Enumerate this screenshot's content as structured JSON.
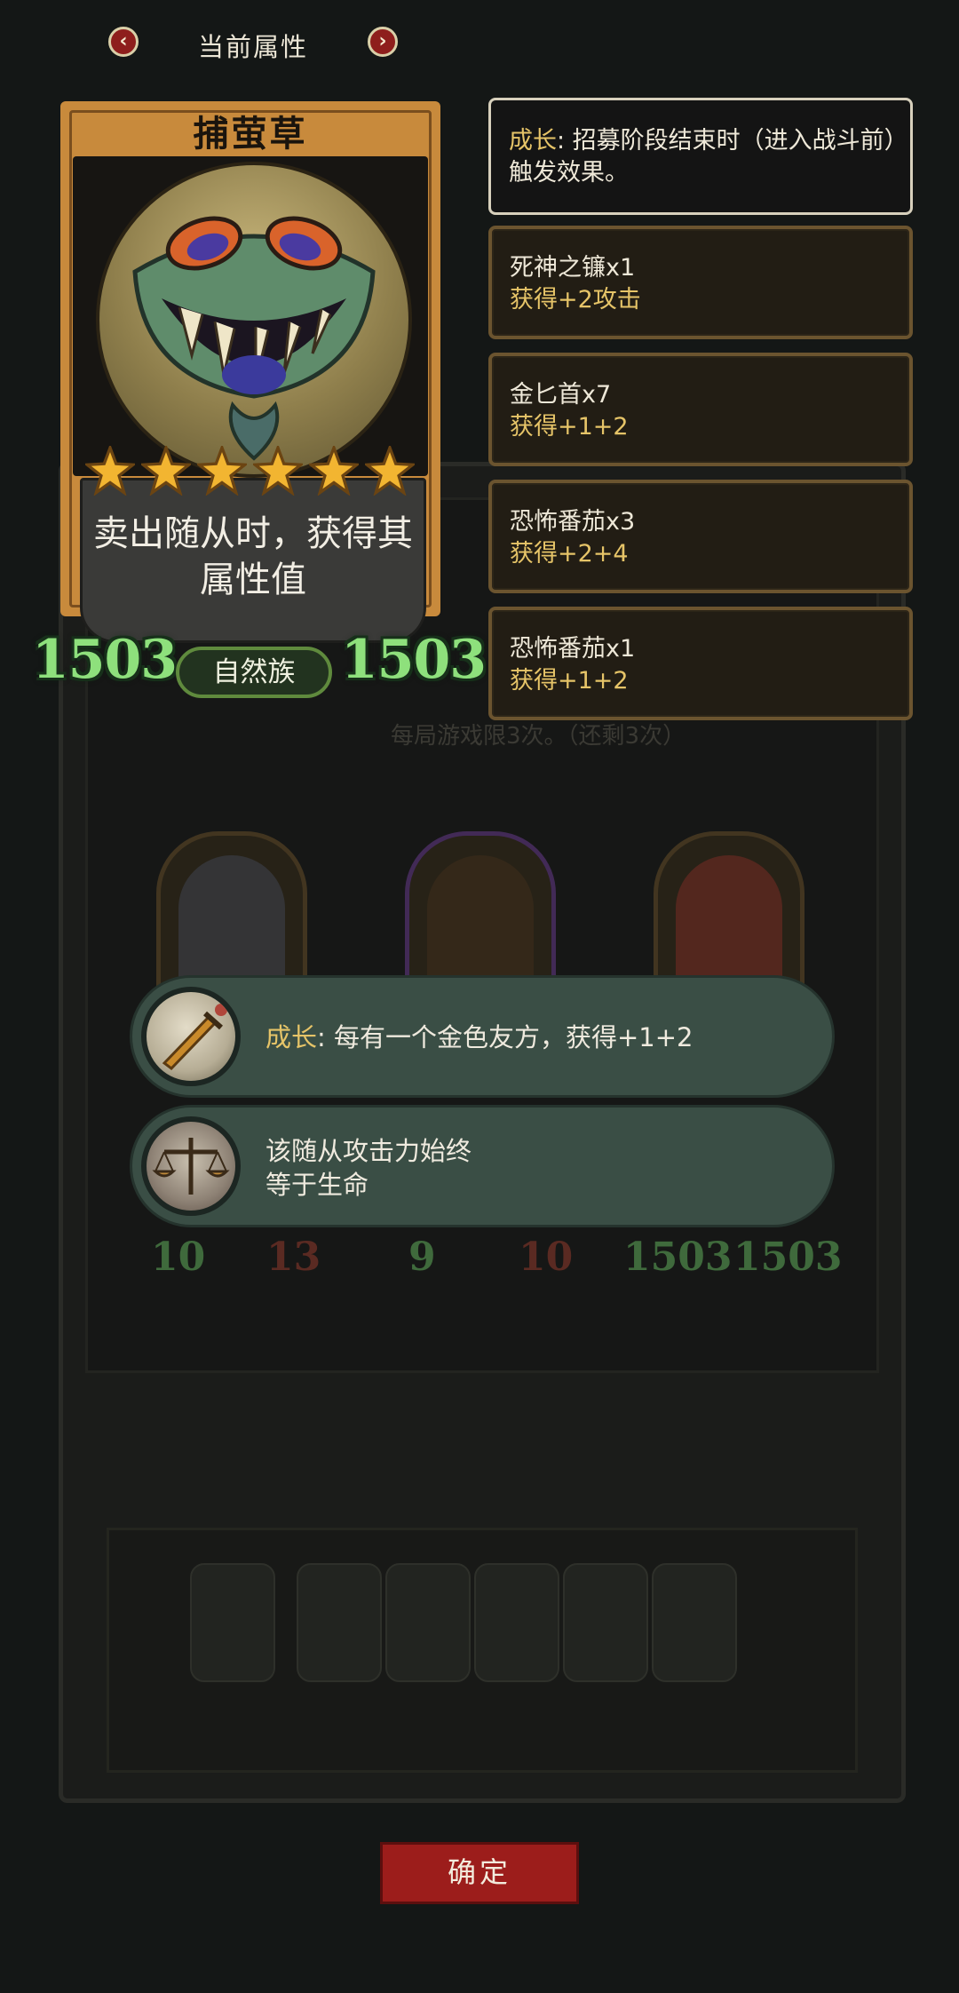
{
  "header": {
    "title": "当前属性",
    "prev_icon": "chevron-left-icon",
    "next_icon": "chevron-right-icon"
  },
  "card": {
    "name": "捕萤草",
    "star_count": 6,
    "description": "卖出随从时，获得其属性值",
    "tribe": "自然族",
    "attack": "1503",
    "health": "1503"
  },
  "effects": {
    "growth": {
      "keyword": "成长",
      "text": ": 招募阶段结束时（进入战斗前）触发效果。"
    },
    "items": [
      {
        "name": "死神之镰x1",
        "effect": "获得+2攻击"
      },
      {
        "name": "金匕首x7",
        "effect": "获得+1+2"
      },
      {
        "name": "恐怖番茄x3",
        "effect": "获得+2+4"
      },
      {
        "name": "恐怖番茄x1",
        "effect": "获得+1+2"
      }
    ]
  },
  "tooltips": [
    {
      "keyword": "成长",
      "text": ": 每有一个金色友方，获得+1+2",
      "icon": "dagger-icon"
    },
    {
      "keyword": "",
      "text": "该随从攻击力始终等于生命",
      "icon": "scale-icon"
    }
  ],
  "background": {
    "partial_text": "每局游戏限3次。（还剩3次）",
    "row_stats": [
      "10",
      "13",
      "9",
      "10",
      "1503",
      "1503"
    ]
  },
  "confirm_label": "确定",
  "colors": {
    "accent_red": "#9c1d1b",
    "stat_green": "#8ee07c",
    "keyword_gold": "#e6c468",
    "card_frame": "#c88a3c",
    "tooltip_bg": "#3a4e45"
  }
}
